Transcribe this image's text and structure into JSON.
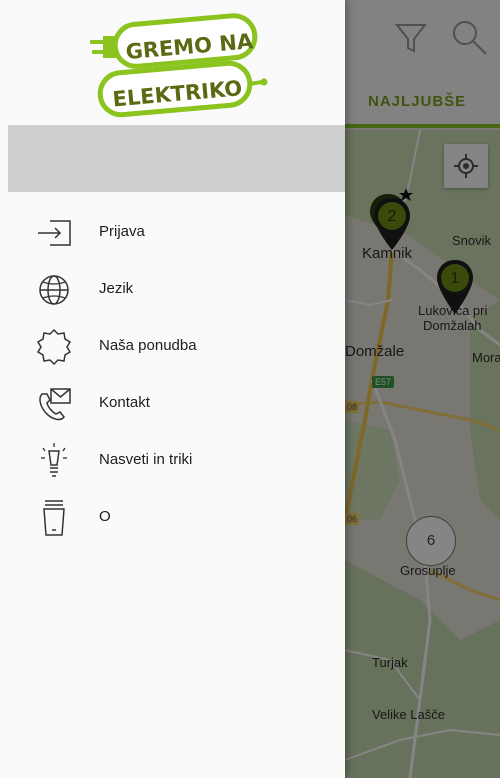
{
  "logo": {
    "line1": "GREMO NA",
    "line2": "ELEKTRIKO"
  },
  "toolbar": {
    "filter_icon": "filter-icon",
    "search_icon": "search-icon",
    "tab_label": "NAJLJUBŠE",
    "accent_color": "#8bc31f"
  },
  "menu": {
    "items": [
      {
        "label": "Prijava",
        "icon": "login-icon"
      },
      {
        "label": "Jezik",
        "icon": "globe-icon"
      },
      {
        "label": "Naša ponudba",
        "icon": "badge-icon"
      },
      {
        "label": "Kontakt",
        "icon": "contact-icon"
      },
      {
        "label": "Nasveti in triki",
        "icon": "lightbulb-icon"
      },
      {
        "label": "O",
        "icon": "info-icon"
      }
    ]
  },
  "map": {
    "places": {
      "kamnik": "Kamnik",
      "snovik": "Snovik",
      "lukovica": "Lukovica pri",
      "lukovica2": "Domžalah",
      "domzale": "Domžale",
      "moravce": "Mora",
      "grosuplje": "Grosuplje",
      "turjak": "Turjak",
      "velike_lasce": "Velike Lašče"
    },
    "roads": {
      "e57": "E57",
      "r108": "08",
      "r106": "06"
    },
    "pins": {
      "kamnik_count": "2",
      "lukovica_count": "1"
    },
    "cluster_count": "6"
  }
}
